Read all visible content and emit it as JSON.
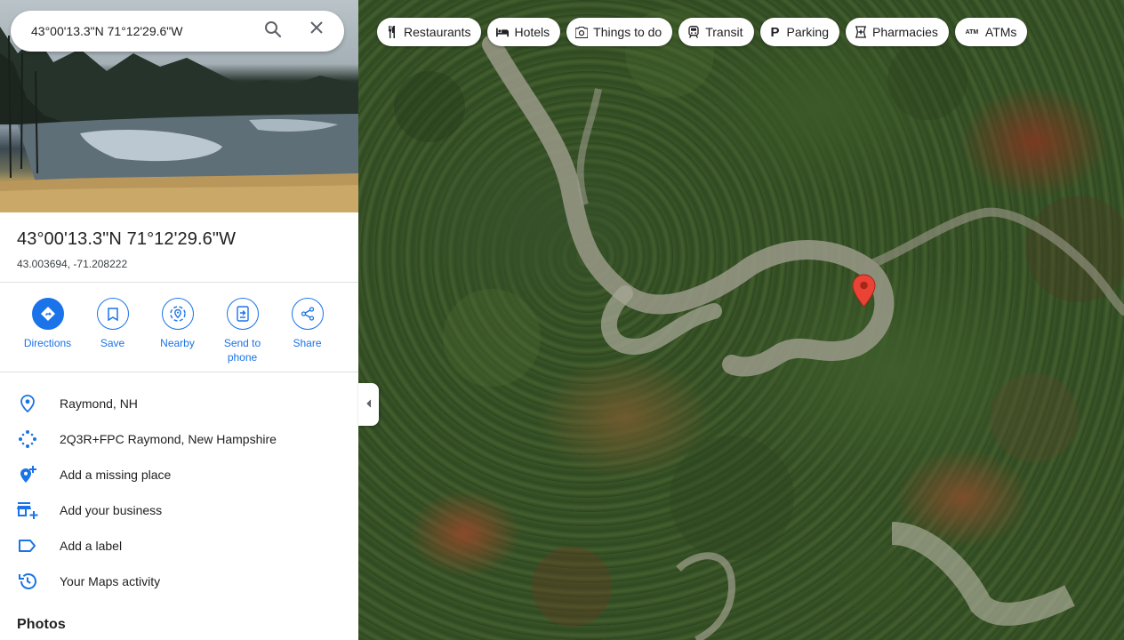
{
  "search": {
    "value": "43°00'13.3\"N 71°12'29.6\"W",
    "search_icon": "search-icon",
    "close_icon": "close-icon"
  },
  "place": {
    "title": "43°00'13.3\"N 71°12'29.6\"W",
    "coords": "43.003694, -71.208222"
  },
  "actions": [
    {
      "label": "Directions",
      "icon": "directions-icon"
    },
    {
      "label": "Save",
      "icon": "bookmark-icon"
    },
    {
      "label": "Nearby",
      "icon": "nearby-icon"
    },
    {
      "label": "Send to phone",
      "icon": "send-to-phone-icon"
    },
    {
      "label": "Share",
      "icon": "share-icon"
    }
  ],
  "info": [
    {
      "text": "Raymond, NH",
      "icon": "location-pin-icon"
    },
    {
      "text": "2Q3R+FPC Raymond, New Hampshire",
      "icon": "plus-code-icon"
    },
    {
      "text": "Add a missing place",
      "icon": "add-place-icon"
    },
    {
      "text": "Add your business",
      "icon": "add-business-icon"
    },
    {
      "text": "Add a label",
      "icon": "label-icon"
    },
    {
      "text": "Your Maps activity",
      "icon": "history-icon"
    }
  ],
  "photos_heading": "Photos",
  "chips": [
    {
      "label": "Restaurants",
      "icon": "fork-knife-icon"
    },
    {
      "label": "Hotels",
      "icon": "bed-icon"
    },
    {
      "label": "Things to do",
      "icon": "camera-icon"
    },
    {
      "label": "Transit",
      "icon": "train-icon"
    },
    {
      "label": "Parking",
      "icon": "parking-icon"
    },
    {
      "label": "Pharmacies",
      "icon": "pharmacy-icon"
    },
    {
      "label": "ATMs",
      "icon": "atm-icon"
    }
  ],
  "colors": {
    "accent": "#1a73e8",
    "pin": "#ea4335"
  }
}
